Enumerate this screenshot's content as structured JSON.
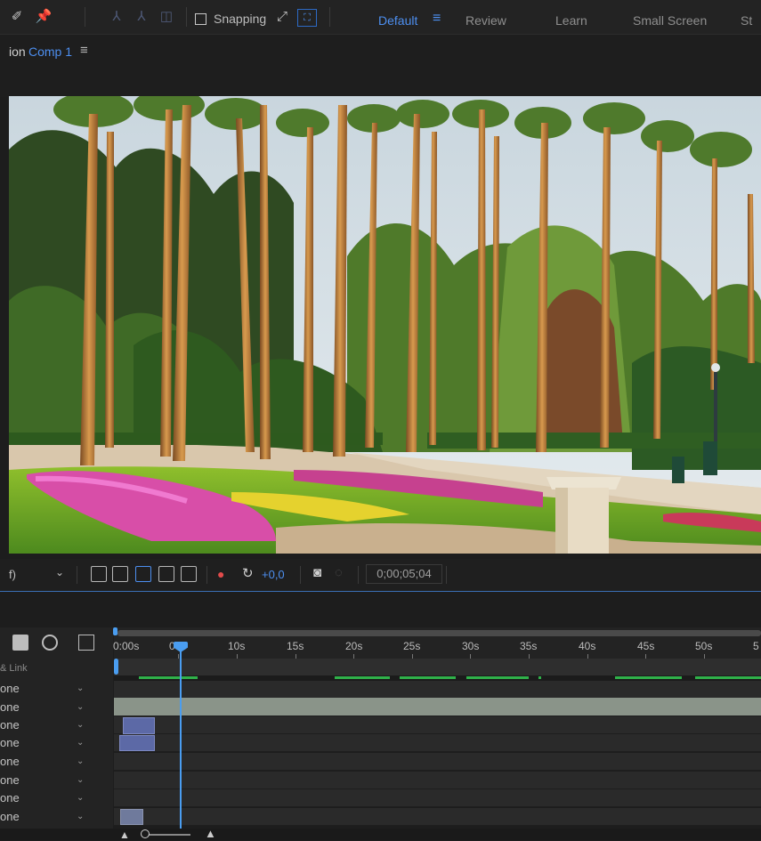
{
  "toolbar": {
    "snapping_label": "Snapping",
    "workspaces": [
      "Default",
      "Review",
      "Learn",
      "Small Screen",
      "St"
    ],
    "menu_glyph": "≡",
    "icons": [
      "brush-tool-icon",
      "pin-tool-icon",
      "puppet-position-icon",
      "puppet-starch-icon",
      "puppet-bend-icon",
      "snapping-edge-icon",
      "snapping-feature-icon"
    ]
  },
  "composition": {
    "title_prefix": "ion",
    "title_name": "Comp 1",
    "menu_glyph": "≡"
  },
  "viewer_bar": {
    "resolution": "f)",
    "dropdown_glyph": "⌄",
    "exposure": "+0,0",
    "timecode": "0;00;05;04"
  },
  "timeline": {
    "parent_link_header": "& Link",
    "ruler_labels": [
      "0:00s",
      "05s",
      "10s",
      "15s",
      "20s",
      "25s",
      "30s",
      "35s",
      "40s",
      "45s",
      "50s",
      "5"
    ],
    "layers": [
      {
        "parent": "one"
      },
      {
        "parent": "one"
      },
      {
        "parent": "one"
      },
      {
        "parent": "one"
      },
      {
        "parent": "one"
      },
      {
        "parent": "one"
      },
      {
        "parent": "one"
      },
      {
        "parent": "one"
      }
    ],
    "dropdown_glyph": "⌄"
  },
  "colors": {
    "accent_blue": "#4d8ff0",
    "playhead": "#4a9df0",
    "render_bar_green": "#2fb14a",
    "clip_purple": "#5c69a6"
  }
}
